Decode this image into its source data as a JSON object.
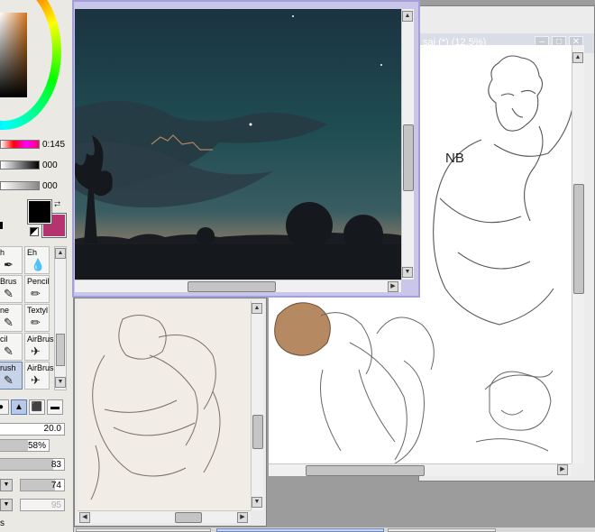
{
  "color_panel": {
    "hsv_v_value": "0:145",
    "slider2_value": "000",
    "slider3_value": "000",
    "colors": {
      "main": "#000000",
      "sub": "#b5336f"
    }
  },
  "tools": {
    "items": [
      {
        "label": "h",
        "icon": "pen-icon"
      },
      {
        "label": "Eh",
        "icon": "eyedropper-icon"
      },
      {
        "label": "Brus",
        "icon": "brush-icon"
      },
      {
        "label": "Pencil",
        "icon": "pencil-icon"
      },
      {
        "label": "ne",
        "icon": "marker-icon"
      },
      {
        "label": "Textyl",
        "icon": "textyl-icon"
      },
      {
        "label": "cil",
        "icon": "pencil-icon"
      },
      {
        "label": "AirBrush",
        "icon": "airbrush-icon"
      },
      {
        "label": "rush",
        "icon": "brush-icon"
      },
      {
        "label": "AirBrush",
        "icon": "airbrush-icon"
      }
    ]
  },
  "brush_settings": {
    "size_value": "20.0",
    "min_size_percent": "58%",
    "min_size_fraction": 0.58,
    "density_value": "83",
    "density_fraction": 0.83,
    "blend_value": "74",
    "dilution_value": "95",
    "footer_char": "s"
  },
  "windows": {
    "right_title": "sai (*) (12.5%)",
    "right_note": "NB"
  }
}
